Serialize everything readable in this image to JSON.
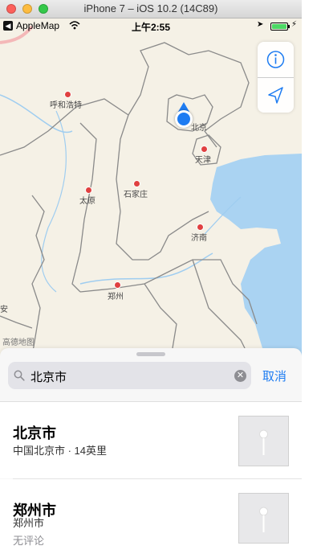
{
  "window": {
    "title": "iPhone 7 – iOS 10.2 (14C89)"
  },
  "status_bar": {
    "back_app": "AppleMap",
    "time": "上午2:55",
    "battery_level": 1.0
  },
  "map": {
    "cities": [
      {
        "name": "呼和浩特",
        "id": "hohhot"
      },
      {
        "name": "北京",
        "id": "beijing"
      },
      {
        "name": "天津",
        "id": "tianjin"
      },
      {
        "name": "太原",
        "id": "taiyuan"
      },
      {
        "name": "石家庄",
        "id": "shijiazhuang"
      },
      {
        "name": "济南",
        "id": "jinan"
      },
      {
        "name": "郑州",
        "id": "zhengzhou"
      },
      {
        "name": "安",
        "id": "xian-partial"
      }
    ],
    "legal": "高德地图",
    "controls": {
      "info_icon": "info-icon",
      "locate_icon": "location-arrow-icon"
    }
  },
  "search": {
    "value": "北京市",
    "cancel_label": "取消"
  },
  "results": [
    {
      "title": "北京市",
      "subtitle": "中国北京市 · 14英里"
    },
    {
      "title": "郑州市",
      "subtitle": "郑州市",
      "review": "无评论"
    }
  ],
  "colors": {
    "accent": "#1e7cf2",
    "map_land": "#f5f1e6",
    "water": "#aad3f2",
    "city_dot": "#e04040"
  }
}
